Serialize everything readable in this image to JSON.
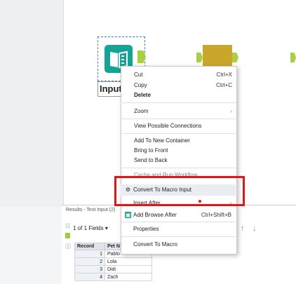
{
  "canvas": {
    "tool_label": "Input"
  },
  "context_menu": {
    "items": [
      {
        "label": "Cut",
        "shortcut": "Ctrl+X"
      },
      {
        "label": "Copy",
        "shortcut": "Ctrl+C"
      },
      {
        "label": "Delete",
        "shortcut": ""
      },
      {
        "label": "Zoom",
        "shortcut": ""
      },
      {
        "label": "View Possible Connections",
        "shortcut": ""
      },
      {
        "label": "Add To New Container",
        "shortcut": ""
      },
      {
        "label": "Bring to Front",
        "shortcut": ""
      },
      {
        "label": "Send to Back",
        "shortcut": ""
      },
      {
        "label": "Cache and Run Workflow",
        "shortcut": ""
      },
      {
        "label": "Convert To Macro Input",
        "shortcut": ""
      },
      {
        "label": "Insert After",
        "shortcut": ""
      },
      {
        "label": "Add Browse After",
        "shortcut": "Ctrl+Shift+B"
      },
      {
        "label": "Properties",
        "shortcut": ""
      },
      {
        "label": "Convert To Macro",
        "shortcut": ""
      }
    ]
  },
  "results": {
    "title": "Results - Text Input (2)",
    "fields_label": "1 of 1 Fields",
    "columns": [
      "Record",
      "Pet N"
    ],
    "rows": [
      {
        "record": "1",
        "value": "Pablo"
      },
      {
        "record": "2",
        "value": "Lola"
      },
      {
        "record": "3",
        "value": "Didi"
      },
      {
        "record": "4",
        "value": "Zach"
      }
    ]
  },
  "colors": {
    "highlight": "#ee1111",
    "tool_teal": "#14a395",
    "anchor_green": "#a8cf45"
  }
}
